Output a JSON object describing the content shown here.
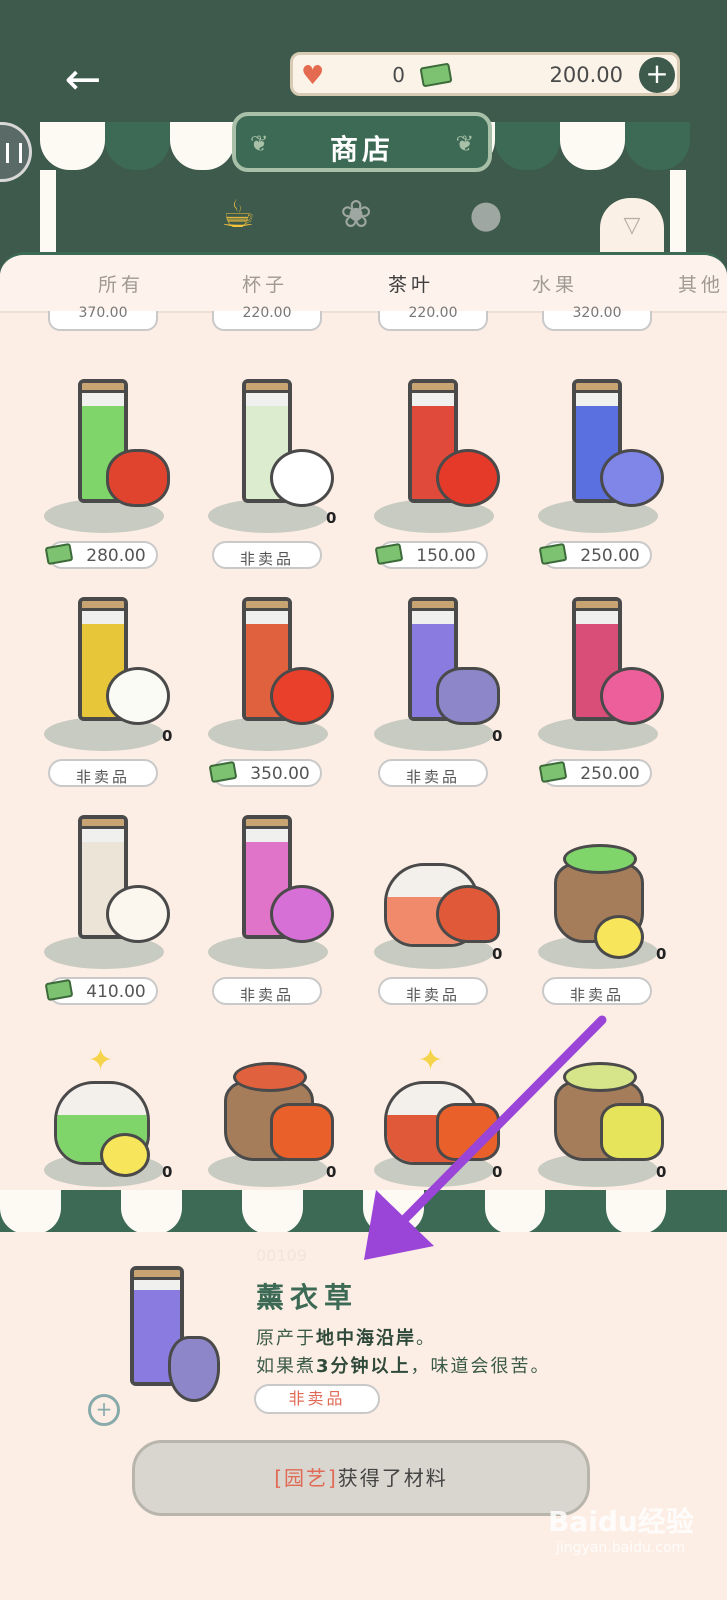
{
  "header": {
    "back_icon": "back-arrow-icon",
    "hearts": "0",
    "money": "200.00",
    "plus_label": "+",
    "title": "商店"
  },
  "categories": {
    "icons": [
      "cup-icon",
      "plant-icon",
      "bear-icon"
    ],
    "subtabs": [
      "所有",
      "杯子",
      "茶叶",
      "水果",
      "其他"
    ],
    "active_subtab": "茶叶"
  },
  "grid": {
    "prev_row_prices": [
      "370.00",
      "220.00",
      "220.00",
      "320.00"
    ],
    "items": [
      {
        "name": "apple-mint",
        "price": "280.00",
        "not_for_sale": false,
        "qty": ""
      },
      {
        "name": "lily-of-valley",
        "price": "非卖品",
        "not_for_sale": true,
        "qty": "0"
      },
      {
        "name": "hibiscus",
        "price": "150.00",
        "not_for_sale": false,
        "qty": ""
      },
      {
        "name": "blue-flower",
        "price": "250.00",
        "not_for_sale": false,
        "qty": ""
      },
      {
        "name": "chamomile",
        "price": "非卖品",
        "not_for_sale": true,
        "qty": "0"
      },
      {
        "name": "rose",
        "price": "350.00",
        "not_for_sale": false,
        "qty": ""
      },
      {
        "name": "lavender",
        "price": "非卖品",
        "not_for_sale": true,
        "qty": "0"
      },
      {
        "name": "pink-flower",
        "price": "250.00",
        "not_for_sale": false,
        "qty": ""
      },
      {
        "name": "jasmine",
        "price": "410.00",
        "not_for_sale": false,
        "qty": ""
      },
      {
        "name": "azalea",
        "price": "非卖品",
        "not_for_sale": true,
        "qty": ""
      },
      {
        "name": "heart-jar",
        "price": "非卖品",
        "not_for_sale": true,
        "qty": "0"
      },
      {
        "name": "leaf-sack",
        "price": "非卖品",
        "not_for_sale": true,
        "qty": "0"
      },
      {
        "name": "lemon-jar",
        "price": "",
        "not_for_sale": true,
        "qty": "0"
      },
      {
        "name": "red-sack",
        "price": "",
        "not_for_sale": true,
        "qty": "0"
      },
      {
        "name": "red-lemon-jar",
        "price": "",
        "not_for_sale": true,
        "qty": "0"
      },
      {
        "name": "yellow-sack",
        "price": "",
        "not_for_sale": true,
        "qty": "0"
      }
    ]
  },
  "detail": {
    "id": "00109",
    "name": "薰衣草",
    "desc_line1_prefix": "原产于",
    "desc_line1_bold": "地中海沿岸",
    "desc_line1_suffix": "。",
    "desc_line2_prefix": "如果煮",
    "desc_line2_bold": "3分钟以上",
    "desc_line2_suffix": "，味道会很苦。",
    "status": "非卖品",
    "source_tag": "[园艺]",
    "source_text": "获得了材料"
  },
  "watermark": {
    "main": "Baidu经验",
    "sub": "jingyan.baidu.com"
  },
  "colors": {
    "theme_green": "#3d5a4c",
    "accent_gold": "#f5c23a",
    "panel_bg": "#fdeee5",
    "annotation_arrow": "#9b45d8"
  }
}
